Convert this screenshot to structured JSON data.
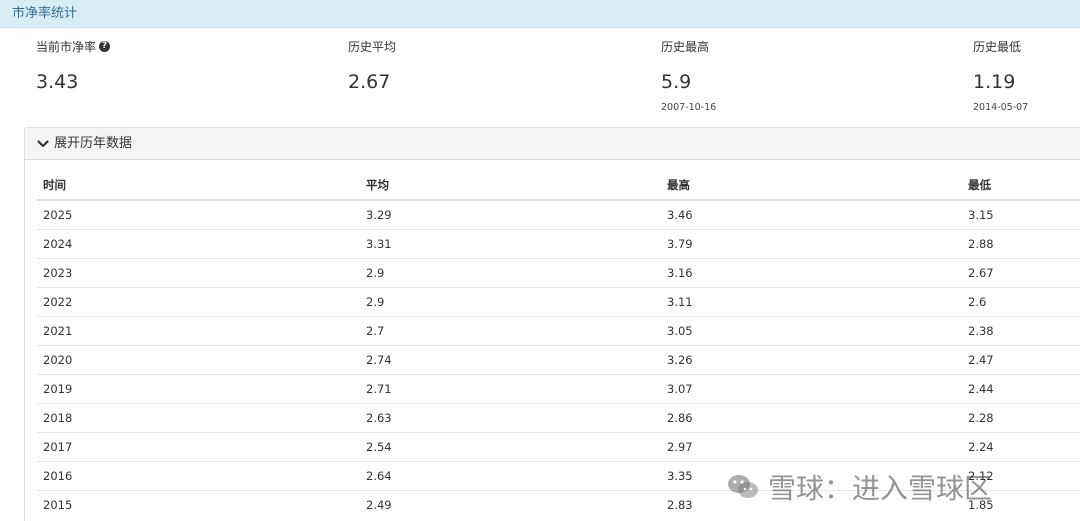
{
  "panel": {
    "title": "市净率统计"
  },
  "stats": [
    {
      "label": "当前市净率",
      "value": "3.43",
      "date": ""
    },
    {
      "label": "历史平均",
      "value": "2.67",
      "date": ""
    },
    {
      "label": "历史最高",
      "value": "5.9",
      "date": "2007-10-16"
    },
    {
      "label": "历史最低",
      "value": "1.19",
      "date": "2014-05-07"
    }
  ],
  "help_icon_glyph": "?",
  "collapse": {
    "label": "展开历年数据"
  },
  "table": {
    "headers": [
      "时间",
      "平均",
      "最高",
      "最低"
    ],
    "rows": [
      [
        "2025",
        "3.29",
        "3.46",
        "3.15"
      ],
      [
        "2024",
        "3.31",
        "3.79",
        "2.88"
      ],
      [
        "2023",
        "2.9",
        "3.16",
        "2.67"
      ],
      [
        "2022",
        "2.9",
        "3.11",
        "2.6"
      ],
      [
        "2021",
        "2.7",
        "3.05",
        "2.38"
      ],
      [
        "2020",
        "2.74",
        "3.26",
        "2.47"
      ],
      [
        "2019",
        "2.71",
        "3.07",
        "2.44"
      ],
      [
        "2018",
        "2.63",
        "2.86",
        "2.28"
      ],
      [
        "2017",
        "2.54",
        "2.97",
        "2.24"
      ],
      [
        "2016",
        "2.64",
        "3.35",
        "2.12"
      ],
      [
        "2015",
        "2.49",
        "2.83",
        "1.85"
      ]
    ]
  },
  "watermark": {
    "text": "雪球：进入雪球区"
  }
}
